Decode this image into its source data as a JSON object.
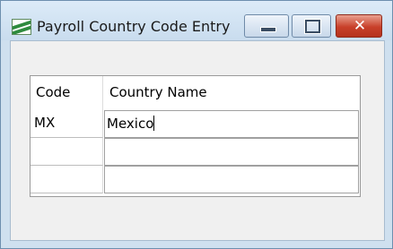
{
  "window": {
    "title": "Payroll Country Code Entry",
    "icon": "payroll-app-icon",
    "controls": {
      "minimize_icon": "minimize-icon",
      "maximize_icon": "maximize-icon",
      "close_glyph": "✕"
    }
  },
  "grid": {
    "columns": [
      "Code",
      "Country Name"
    ],
    "rows": [
      {
        "code": "MX",
        "country_name": "Mexico",
        "editing": true
      },
      {
        "code": "",
        "country_name": ""
      },
      {
        "code": "",
        "country_name": ""
      }
    ]
  },
  "colors": {
    "title_bar": "#c9dcee",
    "close_button": "#c8402a",
    "client_bg": "#f0f0f0"
  }
}
